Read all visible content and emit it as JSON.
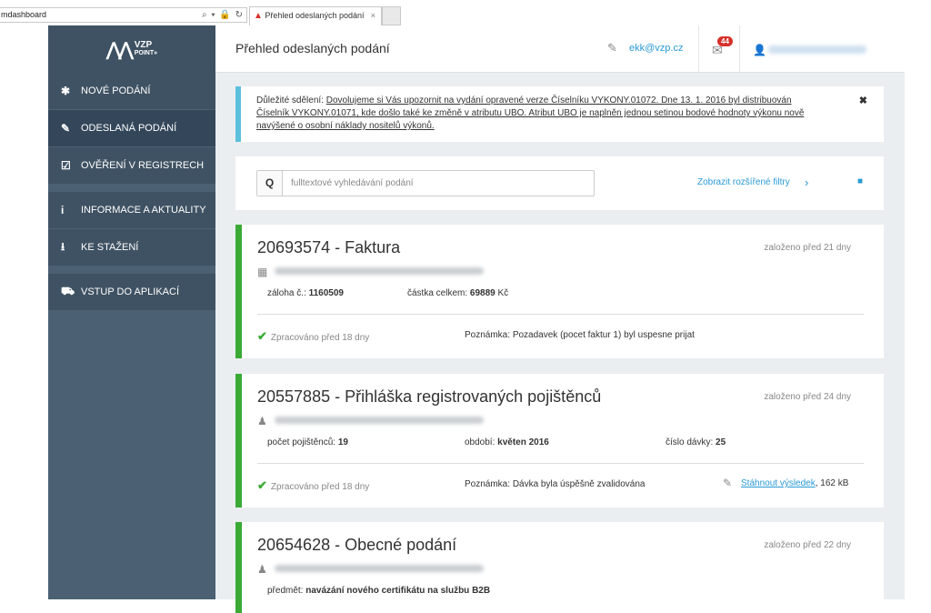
{
  "browser": {
    "address": "mdashboard",
    "address_icons": "⌕ ▾ 🔒 ↻",
    "tab_logo": "▲",
    "tab_title": "Přehled odeslaných podání",
    "tab_close": "×"
  },
  "sidebar": {
    "logo_main": "VZP",
    "logo_sub": "POINT»",
    "items": [
      {
        "icon": "spa-icon",
        "glyph": "✱",
        "label": "NOVÉ PODÁNÍ"
      },
      {
        "icon": "paperclip-icon",
        "glyph": "✎",
        "label": "ODESLANÁ PODÁNÍ"
      },
      {
        "icon": "check-square-icon",
        "glyph": "☑",
        "label": "OVĚŘENÍ V REGISTRECH"
      },
      {
        "icon": "info-icon",
        "glyph": "i",
        "label": "INFORMACE A AKTUALITY"
      },
      {
        "icon": "download-icon",
        "glyph": "⭳",
        "label": "KE STAŽENÍ"
      },
      {
        "icon": "truck-icon",
        "glyph": "⛟",
        "label": "VSTUP DO APLIKACÍ"
      }
    ]
  },
  "header": {
    "title": "Přehled odeslaných podání",
    "email": "ekk@vzp.cz",
    "notification_count": "44"
  },
  "notice": {
    "prefix": "Důležité sdělení: ",
    "text": "Dovolujeme si Vás upozornit na vydání opravené verze Číselníku VYKONY.01072. Dne 13. 1. 2016 byl distribuován Číselník VYKONY.01071, kde došlo také ke změně v atributu UBO. Atribut UBO je naplněn jednou setinou bodové hodnoty výkonu nově navýšené o osobní náklady nositelů výkonů.",
    "close": "✖"
  },
  "search": {
    "placeholder": "fulltextové vyhledávání podání",
    "button_glyph": "Q",
    "filters_label": "Zobrazit rozšířené filtry",
    "filters_chev": "›",
    "trash_glyph": "🗑"
  },
  "cards": [
    {
      "title": "20693574 - Faktura",
      "created": "založeno před 21 dny",
      "org_glyph": "▦",
      "field1_label": "záloha č.: ",
      "field1_value": "1160509",
      "field2_label": "částka celkem: ",
      "field2_value": "69889",
      "field2_suffix": " Kč",
      "status": "Zpracováno před 18 dny",
      "note_label": "Poznámka: ",
      "note_value": "Pozadavek (pocet faktur 1) byl uspesne prijat"
    },
    {
      "title": "20557885 - Přihláška registrovaných pojištěnců",
      "created": "založeno před 24 dny",
      "org_glyph": "♟",
      "field1_label": "počet pojištěnců: ",
      "field1_value": "19",
      "field2_label": "období: ",
      "field2_value": "květen 2016",
      "field3_label": "číslo dávky: ",
      "field3_value": "25",
      "status": "Zpracováno před 18 dny",
      "note_label": "Poznámka: ",
      "note_value": "Dávka byla úspěšně zvalidována",
      "download_label": "Stáhnout výsledek",
      "download_size": ", 162 kB"
    },
    {
      "title": "20654628 - Obecné podání",
      "created": "založeno před 22 dny",
      "org_glyph": "♟",
      "field1_label": "předmět: ",
      "field1_value": "navázání nového certifikátu na službu B2B"
    }
  ],
  "colors": {
    "sidebar": "#4b6072",
    "accent": "#2a9ad6",
    "success": "#3aaa35",
    "info": "#5bc0de",
    "badge": "#d6312a"
  }
}
